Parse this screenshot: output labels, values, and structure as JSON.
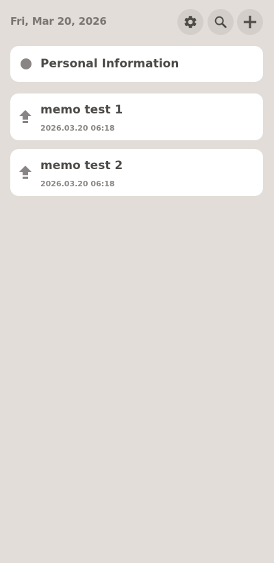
{
  "header": {
    "date": "Fri, Mar 20, 2026",
    "buttons": [
      {
        "icon": "gear-icon"
      },
      {
        "icon": "search-icon"
      },
      {
        "icon": "plus-icon"
      }
    ]
  },
  "pinned": {
    "title": "Personal Information",
    "icon": "dot-icon"
  },
  "memos": [
    {
      "title": "memo test 1",
      "timestamp": "2026.03.20 06:18",
      "icon": "upload-arrow-icon"
    },
    {
      "title": "memo test 2",
      "timestamp": "2026.03.20 06:18",
      "icon": "upload-arrow-icon"
    }
  ],
  "colors": {
    "background": "#e2ddd8",
    "card": "#ffffff",
    "icon_button_bg": "#d3cec9",
    "icon": "#4d4a48",
    "muted": "#8a8684"
  }
}
